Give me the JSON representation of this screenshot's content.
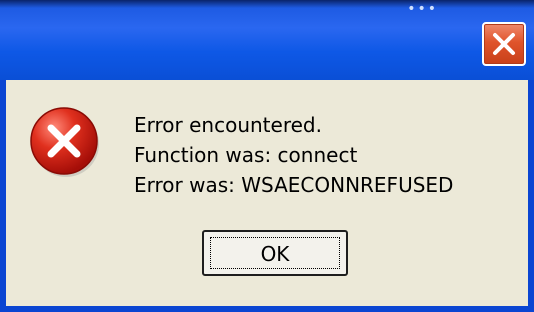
{
  "window": {
    "title_text": "",
    "dots": "•••",
    "close_icon": "close-icon",
    "accent_color": "#0A45D2"
  },
  "dialog": {
    "icon": "error-icon",
    "lines": [
      "Error encountered.",
      "Function was: connect",
      "Error was: WSAECONNREFUSED"
    ],
    "ok_label": "OK"
  }
}
